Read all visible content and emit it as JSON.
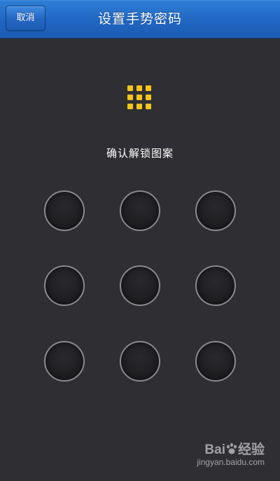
{
  "header": {
    "title": "设置手势密码",
    "cancel_label": "取消",
    "background_color": "#2066c2"
  },
  "main": {
    "prompt": "确认解锁图案",
    "preview_icon": "pattern-grid-icon",
    "preview_color": "#f5c518",
    "pattern_nodes": [
      {
        "row": 1,
        "col": 1
      },
      {
        "row": 1,
        "col": 2
      },
      {
        "row": 1,
        "col": 3
      },
      {
        "row": 2,
        "col": 1
      },
      {
        "row": 2,
        "col": 2
      },
      {
        "row": 2,
        "col": 3
      },
      {
        "row": 3,
        "col": 1
      },
      {
        "row": 3,
        "col": 2
      },
      {
        "row": 3,
        "col": 3
      }
    ]
  },
  "watermark": {
    "logo_left": "Bai",
    "logo_right": "经验",
    "url": "jingyan.baidu.com"
  }
}
